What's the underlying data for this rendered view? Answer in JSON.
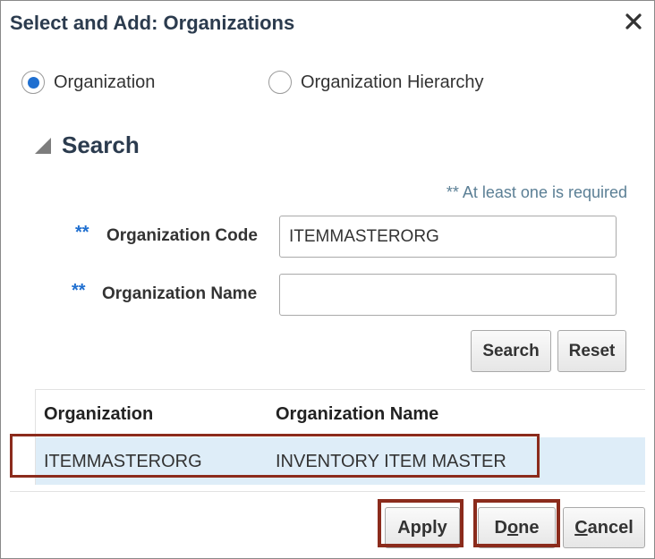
{
  "dialog": {
    "title": "Select and Add: Organizations"
  },
  "mode": {
    "options": [
      {
        "label": "Organization",
        "selected": true
      },
      {
        "label": "Organization Hierarchy",
        "selected": false
      }
    ]
  },
  "search": {
    "heading": "Search",
    "required_note": "** At least one is required",
    "required_marker": "**",
    "fields": [
      {
        "label": "Organization Code",
        "value": "ITEMMASTERORG",
        "placeholder": ""
      },
      {
        "label": "Organization Name",
        "value": "",
        "placeholder": ""
      }
    ],
    "search_label": "Search",
    "reset_label": "Reset"
  },
  "results": {
    "columns": [
      "Organization",
      "Organization Name"
    ],
    "rows": [
      {
        "organization": "ITEMMASTERORG",
        "organization_name": "INVENTORY ITEM MASTER"
      }
    ]
  },
  "footer": {
    "apply": {
      "prefix": "Apply",
      "underline": "",
      "suffix": ""
    },
    "done": {
      "prefix": "D",
      "underline": "o",
      "suffix": "ne"
    },
    "cancel": {
      "prefix": "",
      "underline": "C",
      "suffix": "ancel"
    }
  },
  "colors": {
    "accent": "#1f6fd0",
    "selected_row": "#deedf8",
    "callout": "#8b2b1c"
  },
  "icons": {
    "close": "close-icon",
    "collapse": "disclosure-triangle-icon"
  }
}
